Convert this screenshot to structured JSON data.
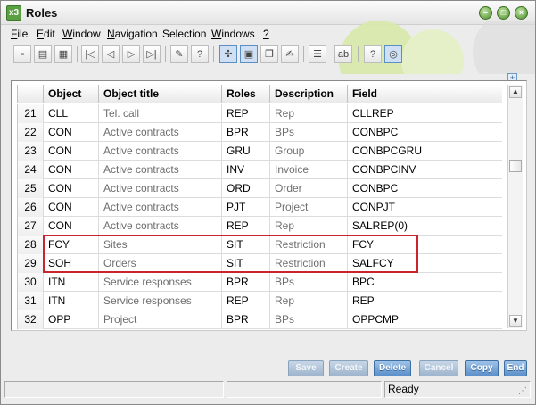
{
  "window": {
    "title": "Roles",
    "app_icon": "x3",
    "controls": [
      "minimize",
      "maximize",
      "close"
    ]
  },
  "menu": [
    {
      "label": "File",
      "underline": "F",
      "rest": "ile"
    },
    {
      "label": "Edit",
      "underline": "E",
      "rest": "dit"
    },
    {
      "label": "Window",
      "underline": "W",
      "rest": "indow"
    },
    {
      "label": "Navigation",
      "underline": "N",
      "rest": "avigation"
    },
    {
      "label": "Selection",
      "underline": "",
      "rest": "Selection"
    },
    {
      "label": "Windows",
      "underline": "W",
      "rest": "indows"
    },
    {
      "label": "?",
      "underline": "?",
      "rest": ""
    }
  ],
  "toolbar": {
    "icons": [
      "new-document-icon",
      "print-icon",
      "print-preview-icon",
      "first-record-icon",
      "previous-record-icon",
      "next-record-icon",
      "last-record-icon",
      "attachment-icon",
      "help-icon",
      "tree-icon",
      "window-layout-icon",
      "copy-window-icon",
      "edit-icon",
      "list-icon",
      "text-icon",
      "info-icon",
      "zoom-icon"
    ],
    "text_button_label": "ab"
  },
  "grid": {
    "columns": [
      "Object",
      "Object title",
      "Roles",
      "Description",
      "Field"
    ],
    "rows": [
      {
        "num": "21",
        "object": "CLL",
        "title": "Tel. call",
        "roles": "REP",
        "description": "Rep",
        "field": "CLLREP"
      },
      {
        "num": "22",
        "object": "CON",
        "title": "Active contracts",
        "roles": "BPR",
        "description": "BPs",
        "field": "CONBPC"
      },
      {
        "num": "23",
        "object": "CON",
        "title": "Active contracts",
        "roles": "GRU",
        "description": "Group",
        "field": "CONBPCGRU"
      },
      {
        "num": "24",
        "object": "CON",
        "title": "Active contracts",
        "roles": "INV",
        "description": "Invoice",
        "field": "CONBPCINV"
      },
      {
        "num": "25",
        "object": "CON",
        "title": "Active contracts",
        "roles": "ORD",
        "description": "Order",
        "field": "CONBPC"
      },
      {
        "num": "26",
        "object": "CON",
        "title": "Active contracts",
        "roles": "PJT",
        "description": "Project",
        "field": "CONPJT"
      },
      {
        "num": "27",
        "object": "CON",
        "title": "Active contracts",
        "roles": "REP",
        "description": "Rep",
        "field": "SALREP(0)"
      },
      {
        "num": "28",
        "object": "FCY",
        "title": "Sites",
        "roles": "SIT",
        "description": "Restriction",
        "field": "FCY"
      },
      {
        "num": "29",
        "object": "SOH",
        "title": "Orders",
        "roles": "SIT",
        "description": "Restriction",
        "field": "SALFCY"
      },
      {
        "num": "30",
        "object": "ITN",
        "title": "Service responses",
        "roles": "BPR",
        "description": "BPs",
        "field": "BPC"
      },
      {
        "num": "31",
        "object": "ITN",
        "title": "Service responses",
        "roles": "REP",
        "description": "Rep",
        "field": "REP"
      },
      {
        "num": "32",
        "object": "OPP",
        "title": "Project",
        "roles": "BPR",
        "description": "BPs",
        "field": "OPPCMP"
      }
    ],
    "highlighted_rows": [
      "28",
      "29"
    ],
    "highlight_color": "#c8262e"
  },
  "actions": [
    {
      "label": "Save",
      "enabled": false
    },
    {
      "label": "Create",
      "enabled": false
    },
    {
      "label": "Delete",
      "enabled": true
    },
    {
      "label": "Cancel",
      "enabled": false
    },
    {
      "label": "Copy",
      "enabled": true
    },
    {
      "label": "End",
      "enabled": true
    }
  ],
  "status": {
    "text": "Ready"
  },
  "colors": {
    "accent_button": "#5b8fc9",
    "title_icon": "#5aa043"
  }
}
